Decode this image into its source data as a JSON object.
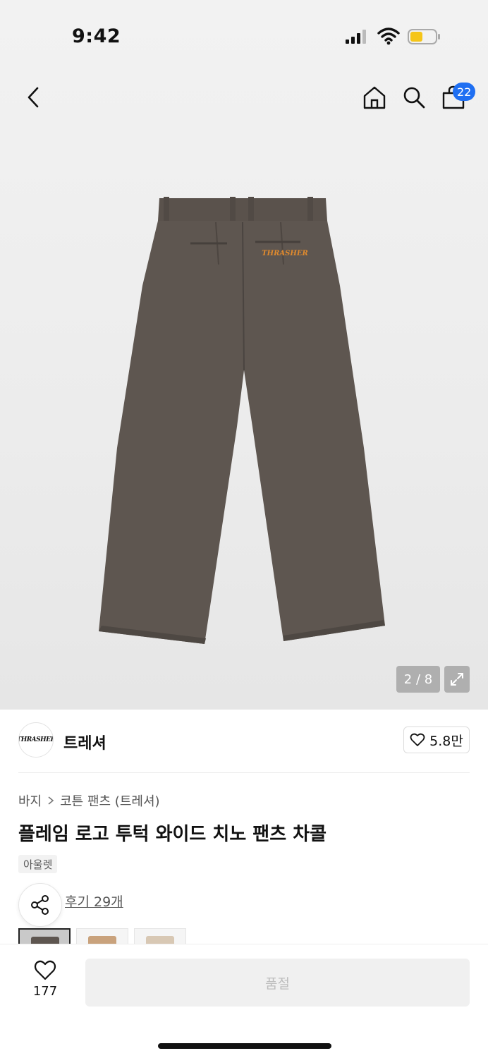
{
  "status_bar": {
    "time": "9:42"
  },
  "nav": {
    "cart_count": "22"
  },
  "gallery": {
    "pager": "2 / 8"
  },
  "brand": {
    "logo_text": "THRASHER",
    "name": "트레셔",
    "likes": "5.8만"
  },
  "breadcrumb": {
    "category": "바지",
    "subcategory": "코튼 팬츠 (트레셔)"
  },
  "product": {
    "title": "플레임 로고 투턱 와이드 치노 팬츠 차콜",
    "tag": "아울렛",
    "review_link": "후기 29개"
  },
  "thumbnails": [
    {
      "color": "#5e5650"
    },
    {
      "color": "#c9a27c"
    },
    {
      "color": "#d8c8b4"
    }
  ],
  "bottom_bar": {
    "wish_count": "177",
    "buy_label": "품절"
  },
  "colors": {
    "accent_badge": "#1f6ff2",
    "battery_fill": "#f5c518",
    "product_fill": "#5e5650",
    "logo_embroidery": "#e08a2e"
  }
}
